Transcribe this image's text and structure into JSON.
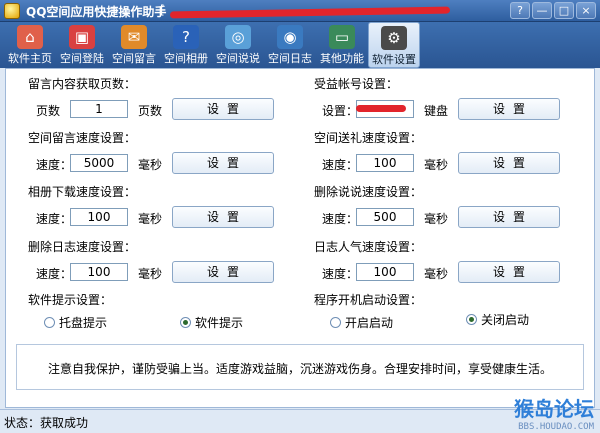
{
  "window": {
    "title": "QQ空间应用快捷操作助手",
    "title_extra": "[",
    "controls": [
      "?",
      "—",
      "□",
      "×"
    ]
  },
  "toolbar": {
    "items": [
      {
        "label": "软件主页",
        "icon": "home-icon",
        "color": "#e0604a"
      },
      {
        "label": "空间登陆",
        "icon": "login-icon",
        "color": "#d94040"
      },
      {
        "label": "空间留言",
        "icon": "message-icon",
        "color": "#e08a2a"
      },
      {
        "label": "空间相册",
        "icon": "album-icon",
        "color": "#2a62b8"
      },
      {
        "label": "空间说说",
        "icon": "talk-icon",
        "color": "#5aa0d8"
      },
      {
        "label": "空间日志",
        "icon": "diary-icon",
        "color": "#3a7ac0"
      },
      {
        "label": "其他功能",
        "icon": "monitor-icon",
        "color": "#3a8a5a"
      },
      {
        "label": "软件设置",
        "icon": "gear-icon",
        "color": "#4a4a4a"
      }
    ],
    "active_index": 7
  },
  "settings": {
    "pages": {
      "title": "留言内容获取页数：",
      "label": "页数",
      "value": "1",
      "unit": "页数",
      "button": "设置"
    },
    "account": {
      "title": "受益帐号设置：",
      "label": "设置：",
      "value": "",
      "unit": "键盘",
      "button": "设置"
    },
    "msg_speed": {
      "title": "空间留言速度设置：",
      "label": "速度：",
      "value": "5000",
      "unit": "毫秒",
      "button": "设置"
    },
    "gift_speed": {
      "title": "空间送礼速度设置：",
      "label": "速度：",
      "value": "100",
      "unit": "毫秒",
      "button": "设置"
    },
    "album_speed": {
      "title": "相册下载速度设置：",
      "label": "速度：",
      "value": "100",
      "unit": "毫秒",
      "button": "设置"
    },
    "talk_speed": {
      "title": "删除说说速度设置：",
      "label": "速度：",
      "value": "500",
      "unit": "毫秒",
      "button": "设置"
    },
    "diary_speed": {
      "title": "删除日志速度设置：",
      "label": "速度：",
      "value": "100",
      "unit": "毫秒",
      "button": "设置"
    },
    "popularity_speed": {
      "title": "日志人气速度设置：",
      "label": "速度：",
      "value": "100",
      "unit": "毫秒",
      "button": "设置"
    },
    "tips": {
      "title": "软件提示设置：",
      "options": [
        {
          "label": "托盘提示",
          "checked": false
        },
        {
          "label": "软件提示",
          "checked": true
        }
      ]
    },
    "autostart": {
      "title": "程序开机启动设置：",
      "options": [
        {
          "label": "开启启动",
          "checked": false
        },
        {
          "label": "关闭启动",
          "checked": true
        }
      ]
    }
  },
  "notice": "注意自我保护，谨防受骗上当。适度游戏益脑，沉迷游戏伤身。合理安排时间，享受健康生活。",
  "status": "状态：获取成功",
  "watermark": {
    "main": "猴岛论坛",
    "sub": "BBS.HOUDAO.COM"
  }
}
